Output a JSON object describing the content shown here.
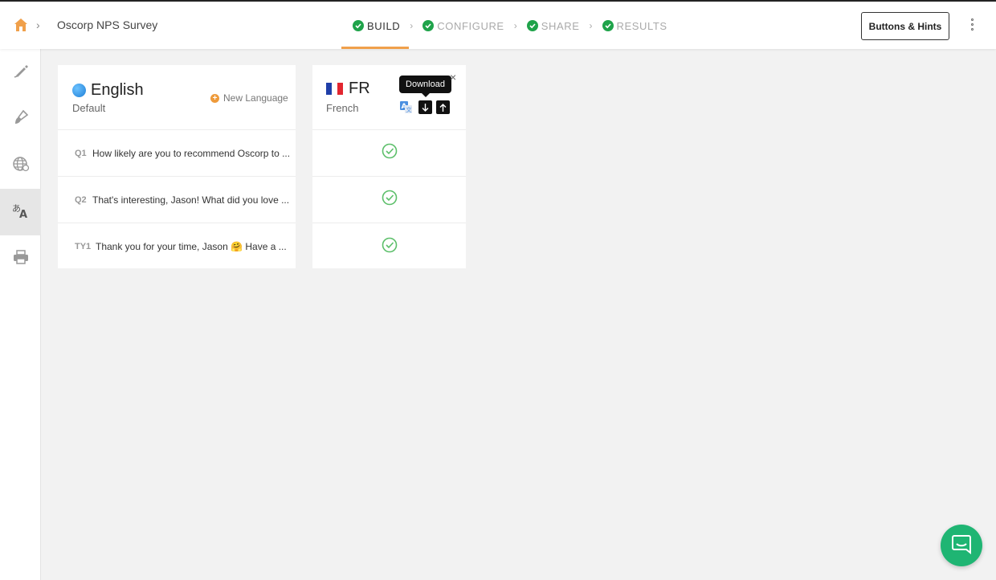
{
  "header": {
    "survey_name": "Oscorp NPS Survey",
    "steps": [
      {
        "label": "BUILD",
        "active": true
      },
      {
        "label": "CONFIGURE",
        "active": false
      },
      {
        "label": "SHARE",
        "active": false
      },
      {
        "label": "RESULTS",
        "active": false
      }
    ],
    "hints_button": "Buttons & Hints",
    "accent_color": "#f0a04b",
    "step_check_color": "#1fa34a"
  },
  "rail": {
    "items": [
      {
        "icon": "pencil-icon",
        "active": false
      },
      {
        "icon": "paintbrush-icon",
        "active": false
      },
      {
        "icon": "globe-icon",
        "active": false
      },
      {
        "icon": "translate-icon",
        "active": true
      },
      {
        "icon": "printer-icon",
        "active": false
      }
    ]
  },
  "english": {
    "title": "English",
    "subtitle": "Default",
    "new_language": "New Language",
    "questions": [
      {
        "code": "Q1",
        "text": "How likely are you to recommend Oscorp to ..."
      },
      {
        "code": "Q2",
        "text": "That's interesting, Jason! What did you love ..."
      },
      {
        "code": "TY1",
        "text": "Thank you for your time, Jason 🤗 Have a ..."
      }
    ]
  },
  "french": {
    "code": "FR",
    "name": "French",
    "tooltip": "Download",
    "close": "×",
    "status": [
      "complete",
      "complete",
      "complete"
    ]
  },
  "chat": {
    "icon": "chat-icon",
    "color": "#1fb573"
  }
}
